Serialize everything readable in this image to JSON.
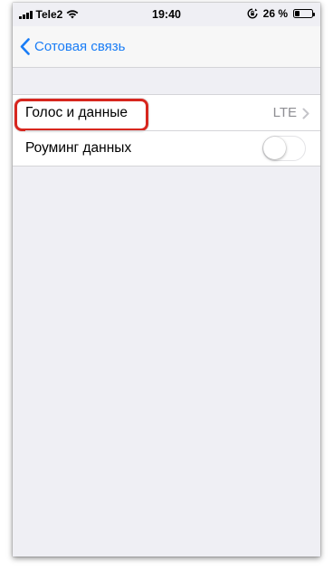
{
  "status_bar": {
    "carrier": "Tele2",
    "time": "19:40",
    "battery_percent": "26 %",
    "battery_level": 0.26,
    "icons": [
      "signal-icon",
      "wifi-icon",
      "orientation-lock-icon",
      "battery-icon"
    ]
  },
  "navbar": {
    "back_label": "Сотовая связь",
    "back_icon": "chevron-left-icon"
  },
  "settings": {
    "rows": [
      {
        "label": "Голос и данные",
        "detail": "LTE",
        "type": "disclosure",
        "highlighted": true
      },
      {
        "label": "Роуминг данных",
        "type": "toggle",
        "on": false
      }
    ]
  },
  "colors": {
    "accent": "#1a7df6",
    "highlight": "#d7261e",
    "background": "#efeff4",
    "detail_text": "#8e8e93"
  }
}
